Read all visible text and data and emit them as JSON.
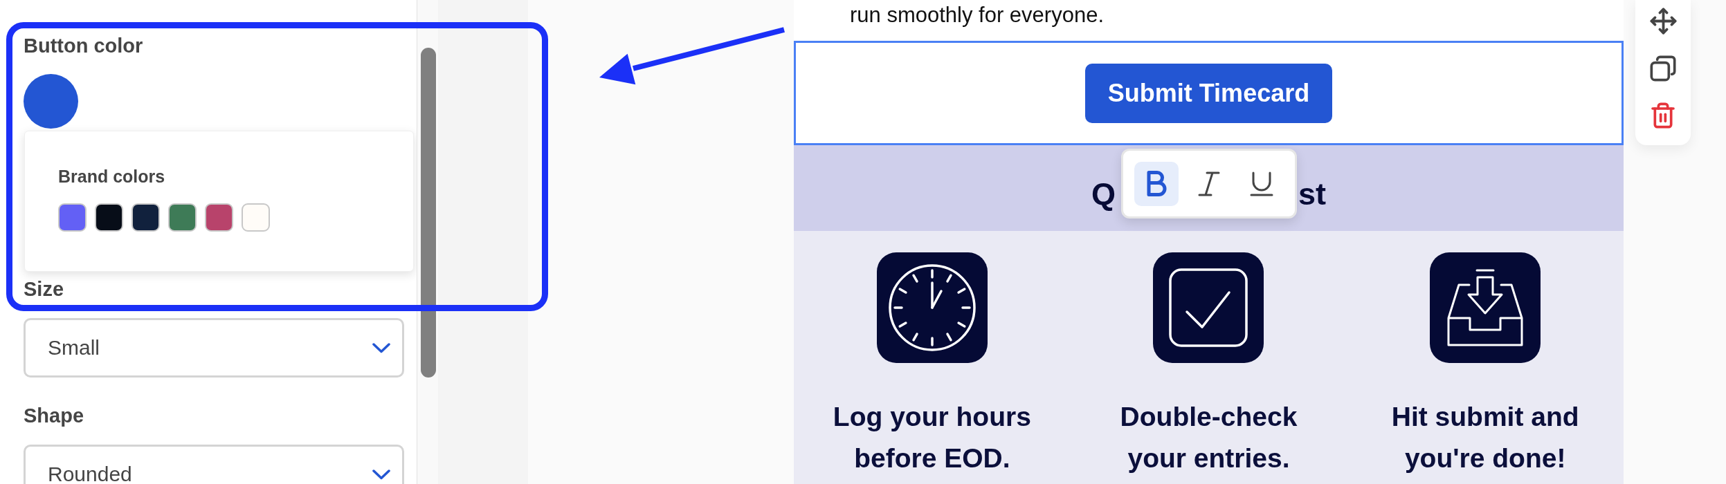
{
  "settings_panel": {
    "button_color": {
      "label": "Button color",
      "color": "#2356d3"
    },
    "brand_colors": {
      "title": "Brand colors",
      "swatches": [
        {
          "color": "#6360f5",
          "selected": false
        },
        {
          "color": "#070d18",
          "selected": false
        },
        {
          "color": "#11213d",
          "selected": false
        },
        {
          "color": "#3e7b57",
          "selected": false
        },
        {
          "color": "#b8436b",
          "selected": false
        },
        {
          "color": "#fffcf8",
          "selected": false
        }
      ]
    },
    "size": {
      "label": "Size",
      "value": "Small"
    },
    "shape": {
      "label": "Shape",
      "value": "Rounded"
    }
  },
  "email": {
    "text": "run smoothly for everyone.",
    "button_block": {
      "selected": true,
      "label": "Submit Timecard"
    },
    "heading_parts": [
      "Q",
      "st"
    ],
    "format_toolbar": [
      {
        "kind": "bold",
        "selected": true
      },
      {
        "kind": "italic",
        "selected": false
      },
      {
        "kind": "underline",
        "selected": false
      }
    ],
    "steps": [
      {
        "kind": "clock",
        "text": "Log your hours before EOD."
      },
      {
        "kind": "check",
        "text": "Double-check your entries."
      },
      {
        "kind": "tray",
        "text": "Hit submit and you're done!"
      }
    ]
  },
  "block_actions": [
    {
      "kind": "move"
    },
    {
      "kind": "copy"
    },
    {
      "kind": "delete"
    }
  ]
}
